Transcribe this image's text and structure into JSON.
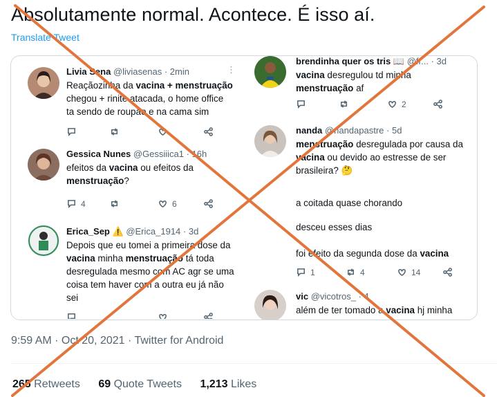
{
  "tweet": {
    "text": "Absolutamente normal. Acontece. É isso aí.",
    "translate_label": "Translate Tweet",
    "meta": "9:59 AM · Oct 20, 2021 · Twitter for Android",
    "stats": {
      "retweets_count": "265",
      "retweets_label": "Retweets",
      "quotes_count": "69",
      "quotes_label": "Quote Tweets",
      "likes_count": "1,213",
      "likes_label": "Likes"
    }
  },
  "cards": {
    "livia": {
      "name": "Livia Sena",
      "handle": "@liviasenas",
      "time": "· 2min",
      "line1_a": "Reaçãozinha da ",
      "line1_b": "vacina + menstruação",
      "line2": "chegou + rinite atacada, o home office",
      "line3": "ta sendo de roupão e na cama sim"
    },
    "gessica": {
      "name": "Gessica Nunes",
      "handle": "@Gessiiica1",
      "time": "· 16h",
      "line1_a": "efeitos da ",
      "line1_b": "vacina",
      "line1_c": " ou efeitos da",
      "line2_b": "menstruação",
      "line2_c": "?",
      "replies": "4",
      "likes": "6"
    },
    "erica": {
      "name": "Erica_Sep",
      "handle": "@Erica_1914",
      "time": "· 3d",
      "line1": "Depois que eu tomei a primeira dose da",
      "line2_a": "vacina",
      "line2_b": " minha ",
      "line2_c": "menstruação",
      "line2_d": " tá toda",
      "line3": "desregulada mesmo com AC agr se uma",
      "line4": "coisa tem haver com a outra eu já não",
      "line5": "sei"
    },
    "brendinha": {
      "name": "brendinha quer os tris",
      "handle": "@fr...",
      "time": "· 3d",
      "line1_a": "vacina",
      "line1_b": " desregulou td minha",
      "line2_a": "menstruação",
      "line2_b": " af",
      "likes": "2"
    },
    "nanda": {
      "name": "nanda",
      "handle": "@nandapastre",
      "time": "· 5d",
      "line1_a": "menstruação",
      "line1_b": " desregulada por causa da",
      "line2_a": "vacina",
      "line2_b": " ou devido ao estresse de ser",
      "line3": "brasileira? 🤔"
    },
    "replies_thread": {
      "r1": "a coitada quase chorando",
      "r2": "desceu esses dias",
      "r3_a": "foi efeito da segunda dose da ",
      "r3_b": "vacina",
      "replies": "1",
      "retweets": "4",
      "likes": "14"
    },
    "vic": {
      "name": "vic",
      "handle": "@vicotros_",
      "time": "· 4",
      "line1_a": "além de ter tomado a ",
      "line1_b": "vacina",
      "line1_c": " hj minha"
    }
  },
  "colors": {
    "accent": "#1d9bf0",
    "x_mark": "#e2753b"
  }
}
